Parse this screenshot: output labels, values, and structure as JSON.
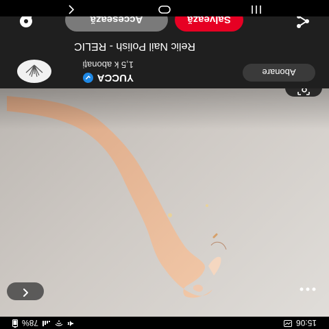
{
  "status": {
    "time": "15:06",
    "battery": "78%",
    "signal_icon": "signal-icon",
    "wifi_icon": "wifi-icon"
  },
  "pin": {
    "image_alt": "hand with manicure"
  },
  "creator": {
    "name": "YUCCA",
    "followers": "1,5 k abonați",
    "verified": true
  },
  "title": "Relic Nail Polish - RELIC",
  "buttons": {
    "follow": "Abonare",
    "save": "Salvează",
    "visit": "Accesează"
  },
  "icons": {
    "back": "back-icon",
    "more": "more-icon",
    "lens": "visual-search-icon",
    "share": "share-icon",
    "comment": "comment-icon",
    "nav_recents": "recents-icon",
    "nav_home": "home-icon",
    "nav_back": "nav-back-icon"
  },
  "colors": {
    "accent": "#e60023",
    "panel": "#1f1f1f",
    "verified": "#1e88e5"
  }
}
